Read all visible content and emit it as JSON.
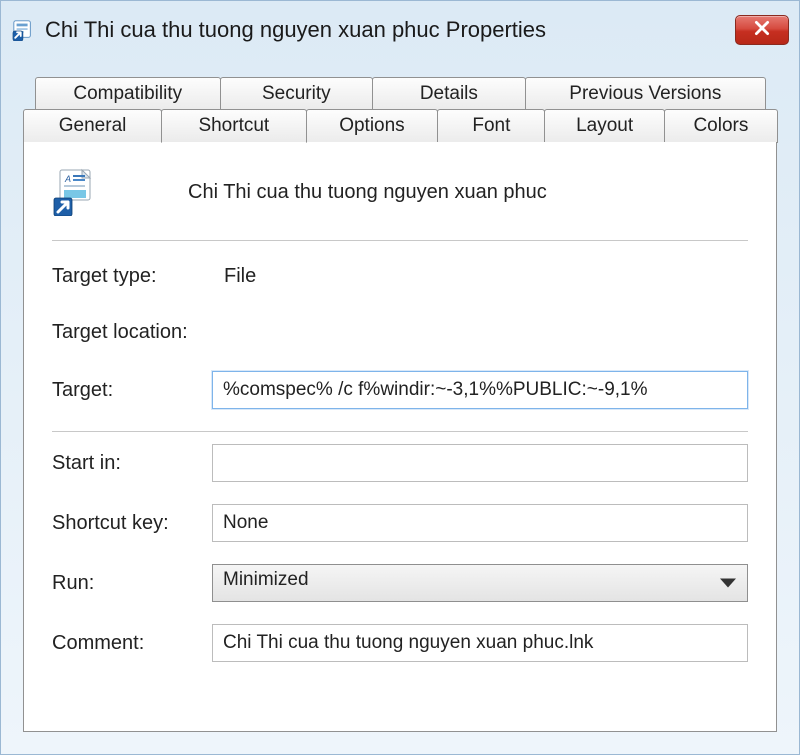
{
  "window": {
    "title": "Chi Thi cua thu tuong nguyen xuan phuc Properties"
  },
  "tabs": {
    "row_back": [
      {
        "label": "Compatibility"
      },
      {
        "label": "Security"
      },
      {
        "label": "Details"
      },
      {
        "label": "Previous Versions"
      }
    ],
    "row_front": [
      {
        "label": "General"
      },
      {
        "label": "Shortcut"
      },
      {
        "label": "Options"
      },
      {
        "label": "Font"
      },
      {
        "label": "Layout"
      },
      {
        "label": "Colors"
      }
    ],
    "active": "Shortcut"
  },
  "shortcut": {
    "heading": "Chi Thi cua thu tuong nguyen xuan phuc",
    "labels": {
      "target_type": "Target type:",
      "target_location": "Target location:",
      "target": "Target:",
      "start_in": "Start in:",
      "shortcut_key": "Shortcut key:",
      "run": "Run:",
      "comment": "Comment:"
    },
    "values": {
      "target_type": "File",
      "target_location": "",
      "target": "%comspec% /c f%windir:~-3,1%%PUBLIC:~-9,1%",
      "start_in": "",
      "shortcut_key": "None",
      "run": "Minimized",
      "comment": "Chi Thi cua thu tuong nguyen xuan phuc.lnk"
    }
  }
}
